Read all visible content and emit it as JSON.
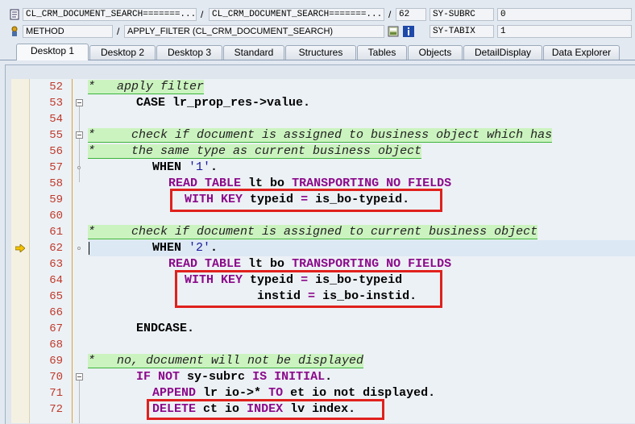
{
  "header": {
    "row1": {
      "program": "CL_CRM_DOCUMENT_SEARCH=======...",
      "include": "CL_CRM_DOCUMENT_SEARCH=======...",
      "line": "62",
      "sysfield_name": "SY-SUBRC",
      "sysfield_value": "0"
    },
    "row2": {
      "event_type": "METHOD",
      "event_name": "APPLY_FILTER (CL_CRM_DOCUMENT_SEARCH)",
      "sysfield_name": "SY-TABIX",
      "sysfield_value": "1"
    },
    "separator": "/"
  },
  "tabs": [
    {
      "label": "Desktop 1",
      "active": true
    },
    {
      "label": "Desktop 2"
    },
    {
      "label": "Desktop 3"
    },
    {
      "label": "Standard"
    },
    {
      "label": "Structures"
    },
    {
      "label": "Tables"
    },
    {
      "label": "Objects"
    },
    {
      "label": "DetailDisplay"
    },
    {
      "label": "Data Explorer"
    }
  ],
  "code": {
    "lines": [
      {
        "num": "52"
      },
      {
        "num": "53"
      },
      {
        "num": "54"
      },
      {
        "num": "55"
      },
      {
        "num": "56"
      },
      {
        "num": "57"
      },
      {
        "num": "58"
      },
      {
        "num": "59"
      },
      {
        "num": "60"
      },
      {
        "num": "61"
      },
      {
        "num": "62"
      },
      {
        "num": "63"
      },
      {
        "num": "64"
      },
      {
        "num": "65"
      },
      {
        "num": "66"
      },
      {
        "num": "67"
      },
      {
        "num": "68"
      },
      {
        "num": "69"
      },
      {
        "num": "70"
      },
      {
        "num": "71"
      },
      {
        "num": "72"
      }
    ],
    "t": {
      "l52": "*   apply filter",
      "l53a": "CASE lr_prop_res->value.",
      "l55": "*     check if document is assigned to business object which has",
      "l56": "*     the same type as current business object",
      "l57a": "WHEN",
      "l57b": "'1'",
      "l57c": ".",
      "l58a": "READ TABLE",
      "l58b": "lt bo",
      "l58c": "TRANSPORTING NO FIELDS",
      "l59a": "WITH KEY",
      "l59b": "typeid",
      "l59c": "=",
      "l59d": "is_bo-typeid.",
      "l61": "*     check if document is assigned to current business object",
      "l62a": "WHEN",
      "l62b": "'2'",
      "l62c": ".",
      "l63a": "READ TABLE",
      "l63b": "lt bo",
      "l63c": "TRANSPORTING NO FIELDS",
      "l64a": "WITH KEY",
      "l64b": "typeid",
      "l64c": "=",
      "l64d": "is_bo-typeid",
      "l65a": "instid",
      "l65b": "=",
      "l65c": "is_bo-instid.",
      "l67a": "ENDCASE.",
      "l69": "*   no, document will not be displayed",
      "l70a": "IF NOT",
      "l70b": "sy-subrc",
      "l70c": "IS INITIAL",
      "l70d": ".",
      "l71a": "APPEND",
      "l71b": "lr io->*",
      "l71c": "TO",
      "l71d": "et io not displayed.",
      "l72a": "DELETE",
      "l72b": "ct io",
      "l72c": "INDEX",
      "l72d": "lv index."
    }
  },
  "colors": {
    "comment_bg": "#cbf3bf",
    "keyword": "#8b0a8b",
    "line_number": "#c0392b",
    "highlight_box": "#e0211d"
  },
  "icons": [
    "program-icon",
    "method-icon",
    "info-icon",
    "execution-arrow-icon"
  ]
}
